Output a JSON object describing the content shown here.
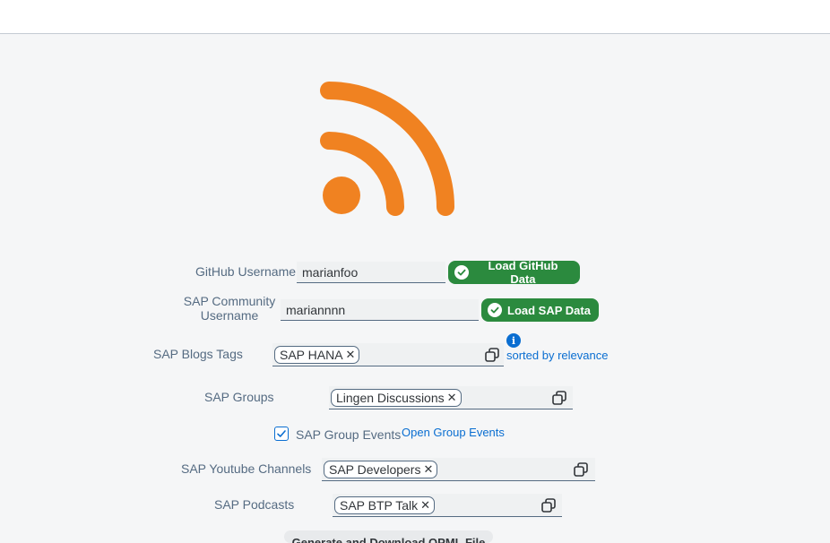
{
  "logo": {
    "icon": "rss-icon",
    "color": "#f08221"
  },
  "github": {
    "label": "GitHub Username",
    "value": "marianfoo",
    "button": "Load GitHub Data"
  },
  "sap_community": {
    "label_line1": "SAP Community",
    "label_line2": "Username",
    "value": "mariannnn",
    "button": "Load SAP Data"
  },
  "blogs": {
    "label": "SAP Blogs Tags",
    "tokens": [
      "SAP HANA"
    ],
    "sort_link": "sorted by relevance",
    "info_glyph": "i"
  },
  "groups": {
    "label": "SAP Groups",
    "tokens": [
      "Lingen Discussions"
    ]
  },
  "events": {
    "checked": true,
    "label": "SAP Group Events",
    "link": "Open Group Events"
  },
  "youtube": {
    "label": "SAP Youtube Channels",
    "tokens": [
      "SAP Developers"
    ]
  },
  "podcasts": {
    "label": "SAP Podcasts",
    "tokens": [
      "SAP BTP Talk"
    ]
  },
  "generate_button": "Generate and Download OPML File",
  "colors": {
    "accent": "#0a6ed1",
    "success": "#2b8a3e",
    "brand": "#f08221"
  }
}
